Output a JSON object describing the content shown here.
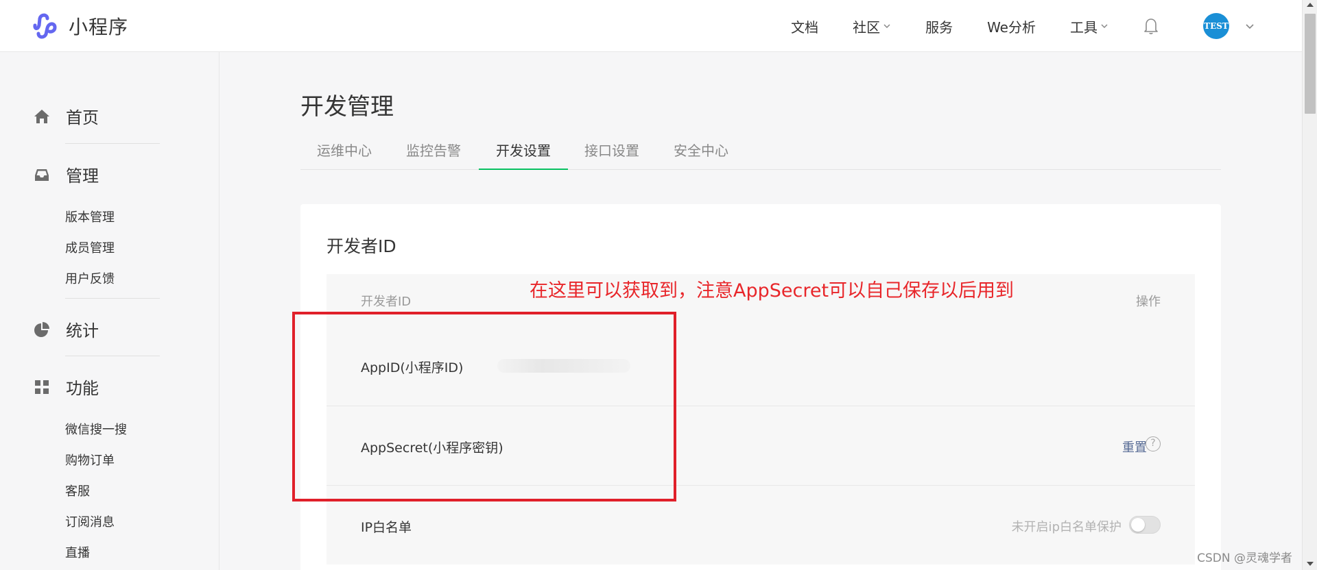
{
  "app": {
    "title": "小程序"
  },
  "topnav": {
    "items": [
      {
        "label": "文档",
        "has_dropdown": false
      },
      {
        "label": "社区",
        "has_dropdown": true
      },
      {
        "label": "服务",
        "has_dropdown": false
      },
      {
        "label": "We分析",
        "has_dropdown": false
      },
      {
        "label": "工具",
        "has_dropdown": true
      }
    ],
    "avatar_text": "TEST",
    "accent": "#1a8fd6"
  },
  "sidebar": {
    "groups": [
      {
        "label": "首页",
        "icon": "home-icon"
      },
      {
        "label": "管理",
        "icon": "inbox-icon",
        "items": [
          "版本管理",
          "成员管理",
          "用户反馈"
        ]
      },
      {
        "label": "统计",
        "icon": "pie-chart-icon"
      },
      {
        "label": "功能",
        "icon": "grid-icon",
        "items": [
          "微信搜一搜",
          "购物订单",
          "客服",
          "订阅消息",
          "直播"
        ]
      }
    ]
  },
  "main": {
    "title": "开发管理",
    "tabs": [
      "运维中心",
      "监控告警",
      "开发设置",
      "接口设置",
      "安全中心"
    ],
    "active_tab": "开发设置",
    "tab_active_color": "#07c160",
    "card": {
      "title": "开发者ID",
      "table": {
        "headers": {
          "left": "开发者ID",
          "right": "操作"
        },
        "rows": [
          {
            "label": "AppID(小程序ID)",
            "value_hidden": true
          },
          {
            "label": "AppSecret(小程序密钥)",
            "action": "重置",
            "help": "?"
          },
          {
            "label": "IP白名单",
            "hint": "未开启ip白名单保护",
            "toggle_on": false
          }
        ]
      }
    }
  },
  "annotation": {
    "text": "在这里可以获取到，注意AppSecret可以自己保存以后用到",
    "color": "#e0202a"
  },
  "watermark": "CSDN @灵魂学者"
}
